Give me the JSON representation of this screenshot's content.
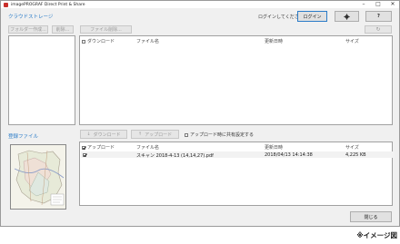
{
  "window": {
    "title": "imagePROGRAF Direct Print & Share"
  },
  "cloud": {
    "section_label": "クラウドストレージ",
    "login_prompt": "ログインしてください。",
    "login_button": "ログイン",
    "settings_icon": "gear-icon",
    "help_button": "?",
    "new_folder_button": "フォルダー作成...",
    "delete_button": "削除...",
    "delete_file_button": "ファイル削除...",
    "refresh_icon": "refresh-icon",
    "columns": {
      "download": "ダウンロード",
      "filename": "ファイル名",
      "updated": "更新日時",
      "size": "サイズ"
    }
  },
  "registered": {
    "section_label": "登録ファイル",
    "download_button": "ダウンロード",
    "upload_button": "アップロード",
    "share_option": "アップロード時に共有設定する",
    "columns": {
      "upload": "アップロード",
      "filename": "ファイル名",
      "updated": "更新日時",
      "size": "サイズ"
    },
    "rows": [
      {
        "checked": true,
        "filename": "スキャン 2018-4-13 (14,14,27).pdf",
        "updated": "2018/04/13 14:14:38",
        "size": "4,225 KB"
      }
    ]
  },
  "footer": {
    "close_button": "閉じる"
  },
  "caption": "※イメージ図",
  "colors": {
    "accent": "#2b7cc8",
    "window_bg": "#f0f0f0"
  }
}
